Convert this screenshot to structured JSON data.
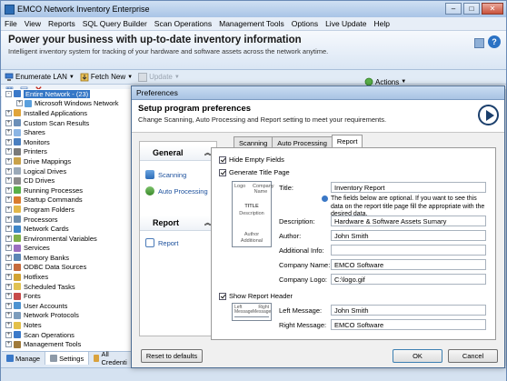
{
  "window": {
    "title": "EMCO Network Inventory Enterprise"
  },
  "menu": [
    "File",
    "View",
    "Reports",
    "SQL Query Builder",
    "Scan Operations",
    "Management Tools",
    "Options",
    "Live Update",
    "Help"
  ],
  "banner": {
    "title": "Power your business with up-to-date inventory information",
    "subtitle": "Intelligent inventory system for tracking of your hardware and software assets across the network anytime."
  },
  "toolbar": {
    "enumerate": "Enumerate LAN",
    "fetch": "Fetch New",
    "update": "Update",
    "actions": "Actions"
  },
  "tree": [
    {
      "label": "Entire Network - (23)",
      "selected": true,
      "level": 0,
      "expander": "-"
    },
    {
      "label": "Microsoft Windows Network",
      "level": 1,
      "expander": "+"
    },
    {
      "label": "Installed Applications",
      "level": 0,
      "expander": "+"
    },
    {
      "label": "Custom Scan Results",
      "level": 0,
      "expander": "+"
    },
    {
      "label": "Shares",
      "level": 0,
      "expander": "+"
    },
    {
      "label": "Monitors",
      "level": 0,
      "expander": "+"
    },
    {
      "label": "Printers",
      "level": 0,
      "expander": "+"
    },
    {
      "label": "Drive Mappings",
      "level": 0,
      "expander": "+"
    },
    {
      "label": "Logical Drives",
      "level": 0,
      "expander": "+"
    },
    {
      "label": "CD Drives",
      "level": 0,
      "expander": "+"
    },
    {
      "label": "Running Processes",
      "level": 0,
      "expander": "+"
    },
    {
      "label": "Startup Commands",
      "level": 0,
      "expander": "+"
    },
    {
      "label": "Program Folders",
      "level": 0,
      "expander": "+"
    },
    {
      "label": "Processors",
      "level": 0,
      "expander": "+"
    },
    {
      "label": "Network Cards",
      "level": 0,
      "expander": "+"
    },
    {
      "label": "Environmental Variables",
      "level": 0,
      "expander": "+"
    },
    {
      "label": "Services",
      "level": 0,
      "expander": "+"
    },
    {
      "label": "Memory Banks",
      "level": 0,
      "expander": "+"
    },
    {
      "label": "ODBC Data Sources",
      "level": 0,
      "expander": "+"
    },
    {
      "label": "Hotfixes",
      "level": 0,
      "expander": "+"
    },
    {
      "label": "Scheduled Tasks",
      "level": 0,
      "expander": "+"
    },
    {
      "label": "Fonts",
      "level": 0,
      "expander": "+"
    },
    {
      "label": "User Accounts",
      "level": 0,
      "expander": "+"
    },
    {
      "label": "Network Protocols",
      "level": 0,
      "expander": "+"
    },
    {
      "label": "Notes",
      "level": 0,
      "expander": "+"
    },
    {
      "label": "Scan Operations",
      "level": 0,
      "expander": "+"
    },
    {
      "label": "Management Tools",
      "level": 0,
      "expander": "+"
    }
  ],
  "bottom_tabs": [
    "Manage",
    "Settings",
    "All Credenti"
  ],
  "dialog": {
    "title": "Preferences",
    "head_title": "Setup program preferences",
    "head_sub": "Change Scanning, Auto Processing and Report setting to meet your requirements.",
    "nav": {
      "general_header": "General",
      "scanning": "Scanning",
      "auto_processing": "Auto Processing",
      "report_header": "Report",
      "report": "Report"
    },
    "tabs": [
      "Scanning",
      "Auto Processing",
      "Report"
    ],
    "hide_empty_fields": "Hide Empty Fields",
    "generate_title_page": "Generate Title Page",
    "title_label": "Title:",
    "title_value": "Inventory Report",
    "note": "The fields below are optional. If you want to see this data on the report title page fill the appropriate with the desired data.",
    "description_label": "Description:",
    "description_value": "Hardware & Software Assets Sumary",
    "author_label": "Author:",
    "author_value": "John Smith",
    "additional_label": "Additional Info:",
    "additional_value": "",
    "company_label": "Company Name:",
    "company_value": "EMCO Software",
    "logo_label": "Company Logo:",
    "logo_value": "C:\\logo.gif",
    "show_report_header": "Show Report Header",
    "left_msg_label": "Left Message:",
    "left_msg_value": "John Smith",
    "right_msg_label": "Right Message:",
    "right_msg_value": "EMCO Software",
    "reset": "Reset to defaults",
    "ok": "OK",
    "cancel": "Cancel",
    "preview_title": {
      "logo": "Logo",
      "company": "Company Name",
      "title": "TITLE",
      "description": "Description",
      "author": "Author",
      "additional": "Additional"
    },
    "preview_header": {
      "left": "Left Message",
      "right": "Right Message"
    }
  },
  "colors": {
    "accent": "#3577c6",
    "link": "#1a4f9c"
  }
}
